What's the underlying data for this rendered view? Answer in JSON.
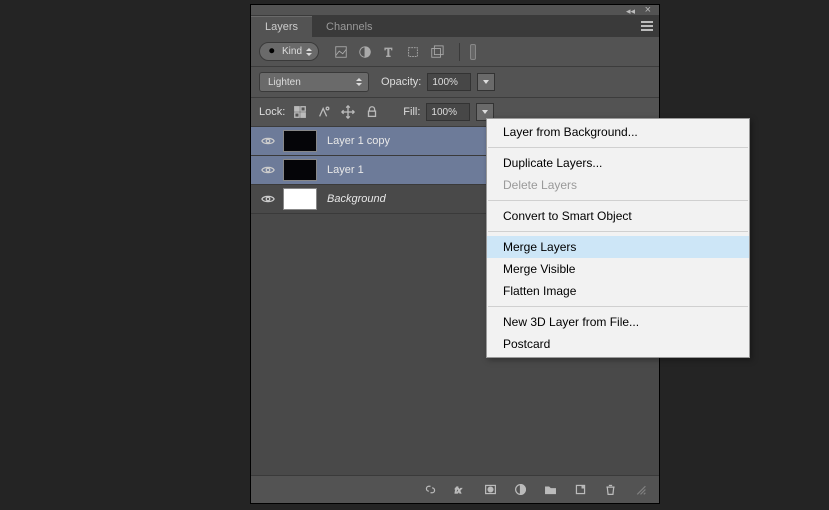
{
  "panel": {
    "tabs": [
      {
        "label": "Layers",
        "active": true
      },
      {
        "label": "Channels",
        "active": false
      }
    ]
  },
  "filter": {
    "kind_label": "Kind"
  },
  "blend": {
    "mode": "Lighten",
    "opacity_label": "Opacity:",
    "opacity_value": "100%"
  },
  "lock": {
    "label": "Lock:",
    "fill_label": "Fill:",
    "fill_value": "100%"
  },
  "layers": [
    {
      "name": "Layer 1 copy",
      "selected": true,
      "visible": true,
      "thumb": "dark"
    },
    {
      "name": "Layer 1",
      "selected": true,
      "visible": true,
      "thumb": "dark"
    },
    {
      "name": "Background",
      "selected": false,
      "visible": true,
      "thumb": "white",
      "italic": true
    }
  ],
  "context_menu": {
    "items": [
      {
        "label": "Layer from Background...",
        "type": "item"
      },
      {
        "type": "sep"
      },
      {
        "label": "Duplicate Layers...",
        "type": "item"
      },
      {
        "label": "Delete Layers",
        "type": "item",
        "disabled": true
      },
      {
        "type": "sep"
      },
      {
        "label": "Convert to Smart Object",
        "type": "item"
      },
      {
        "type": "sep"
      },
      {
        "label": "Merge Layers",
        "type": "item",
        "highlight": true
      },
      {
        "label": "Merge Visible",
        "type": "item"
      },
      {
        "label": "Flatten Image",
        "type": "item"
      },
      {
        "type": "sep"
      },
      {
        "label": "New 3D Layer from File...",
        "type": "item"
      },
      {
        "label": "Postcard",
        "type": "item"
      }
    ]
  }
}
